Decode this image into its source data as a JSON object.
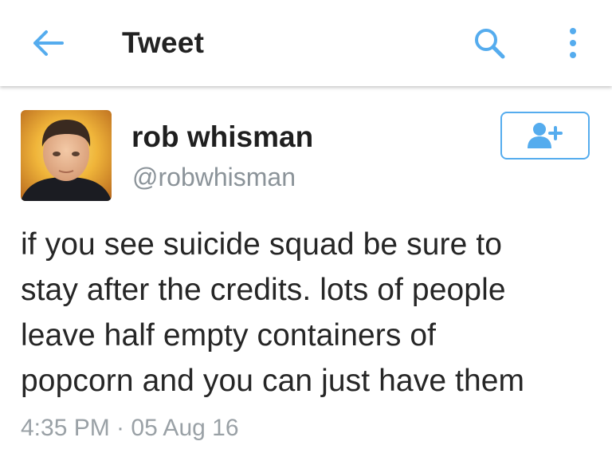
{
  "header": {
    "title": "Tweet",
    "back_icon": "arrow-left-icon",
    "search_icon": "search-icon",
    "more_icon": "more-vertical-icon",
    "accent_color": "#55acee"
  },
  "tweet": {
    "author": {
      "display_name": "rob whisman",
      "handle": "@robwhisman",
      "avatar": "avatar"
    },
    "follow_icon": "add-user-icon",
    "text": "if you see suicide squad be sure to\nstay after the credits. lots of people\nleave half empty containers of\npopcorn and you can just have them",
    "timestamp": "4:35 PM · 05 Aug 16"
  }
}
